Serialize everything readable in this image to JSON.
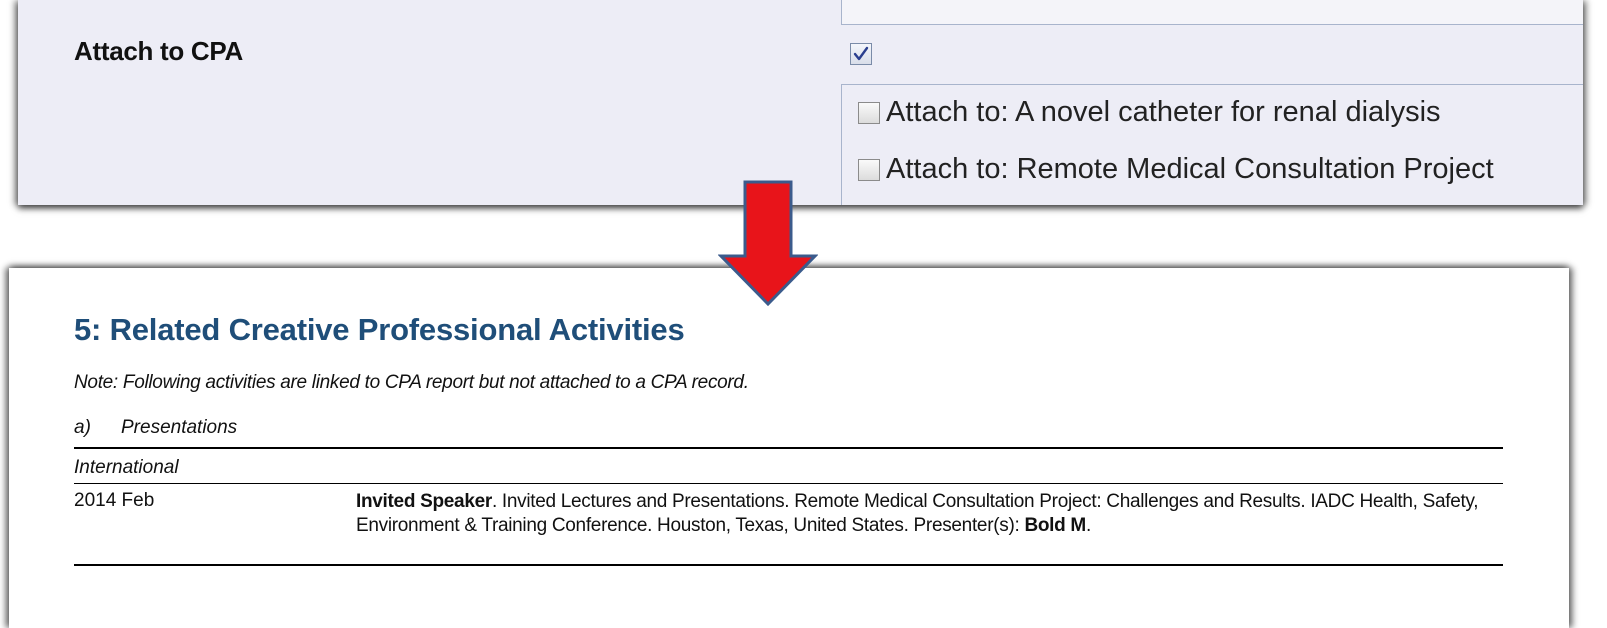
{
  "form": {
    "field_label": "Attach to CPA",
    "attach_to_cpa_checked": true,
    "attach_options": [
      {
        "label": "Attach to: A novel catheter for renal dialysis",
        "checked": false
      },
      {
        "label": "Attach to: Remote Medical Consultation Project",
        "checked": false
      }
    ]
  },
  "arrow": {
    "color": "#e8141a",
    "outline": "#3b5b8c",
    "icon": "down-arrow-icon"
  },
  "report": {
    "section_title": "5: Related Creative Professional Activities",
    "note": "Note: Following activities are linked to CPA report but not attached to a CPA record.",
    "subsection_letter": "a)",
    "subsection_title": "Presentations",
    "category": "International",
    "entry": {
      "date": "2014 Feb",
      "role": "Invited Speaker",
      "description": ". Invited Lectures and Presentations. Remote Medical Consultation Project: Challenges and Results. IADC Health, Safety, Environment & Training Conference. Houston, Texas, United States. Presenter(s): ",
      "presenter": "Bold M",
      "end": "."
    }
  },
  "colors": {
    "title_blue": "#1f4e79",
    "form_background": "#ededf6"
  }
}
